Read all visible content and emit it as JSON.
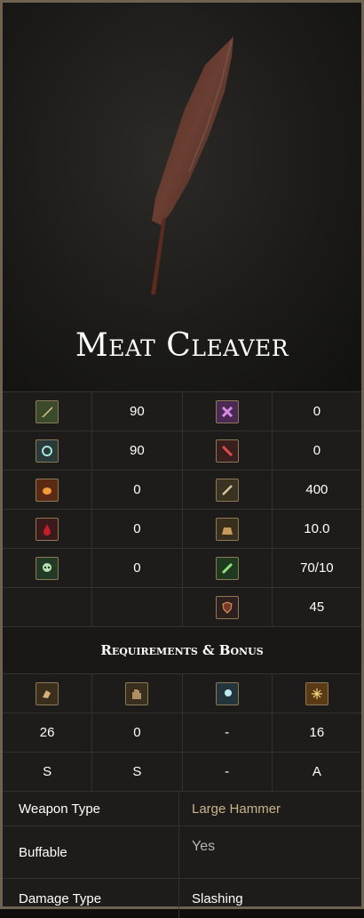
{
  "item": {
    "name": "Meat Cleaver"
  },
  "stats": [
    [
      {
        "icon": "physical-damage-icon",
        "value": "90"
      },
      {
        "icon": "cross-icon",
        "value": "0"
      }
    ],
    [
      {
        "icon": "magic-damage-icon",
        "value": "90"
      },
      {
        "icon": "slash-red-icon",
        "value": "0"
      }
    ],
    [
      {
        "icon": "fire-damage-icon",
        "value": "0"
      },
      {
        "icon": "durability-icon",
        "value": "400"
      }
    ],
    [
      {
        "icon": "blood-icon",
        "value": "0"
      },
      {
        "icon": "weight-icon",
        "value": "10.0"
      }
    ],
    [
      {
        "icon": "skull-icon",
        "value": "0"
      },
      {
        "icon": "stamina-icon",
        "value": "70/10"
      }
    ],
    [
      {
        "icon": "",
        "value": ""
      },
      {
        "icon": "shield-icon",
        "value": "45"
      }
    ]
  ],
  "requirements": {
    "title": "Requirements & Bonus",
    "icons": [
      "strength-icon",
      "dexterity-icon",
      "intelligence-icon",
      "faith-icon"
    ],
    "values": [
      "26",
      "0",
      "-",
      "16"
    ],
    "grades": [
      "S",
      "S",
      "-",
      "A"
    ]
  },
  "info": [
    {
      "label": "Weapon Type",
      "value": "Large Hammer",
      "color": "#c9b48c"
    },
    {
      "label": "Buffable",
      "value": "Yes",
      "color": "#b7b7b7"
    },
    {
      "label": "Damage Type",
      "value": "Slashing",
      "color": "#ffffff"
    }
  ],
  "colors": {
    "border": "#6e6350",
    "accent": "#c9b48c"
  }
}
